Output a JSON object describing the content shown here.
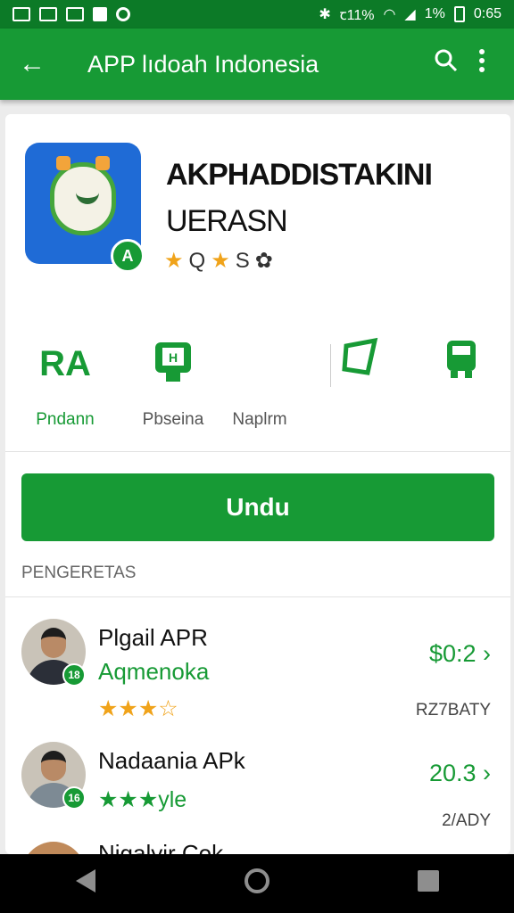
{
  "status_bar": {
    "battery_text": "1%",
    "extra_text": "ꞇ11%",
    "time": "0:65",
    "icons": [
      "image-icon",
      "cast-icon",
      "camera-icon",
      "square-icon",
      "record-icon",
      "bluetooth-icon",
      "wifi-icon",
      "signal-icon",
      "battery-icon"
    ]
  },
  "app_bar": {
    "title": "APP lıdoah Indonesia",
    "back_icon": "←",
    "search_icon": "search-icon",
    "more_icon": "more-vert-icon"
  },
  "app": {
    "title_line1": "AKPHADDISTAKINI",
    "title_line2": "UERASN",
    "rating_text_1": "Q",
    "rating_text_2": "S",
    "badge": "A",
    "icon_colors": {
      "background": "#1f6bd6",
      "robot": "#45a63c"
    }
  },
  "actions": [
    {
      "icon_text": "RA",
      "label": "Pndann"
    },
    {
      "icon_text": "H",
      "label": "Pbseina"
    },
    {
      "icon_text": "",
      "label": "Naplrm"
    },
    {
      "icon_text": "",
      "label": ""
    }
  ],
  "install_button": {
    "label": "Undu"
  },
  "section_title": "PENGERETAS",
  "list": [
    {
      "name": "Plgail APR",
      "subtitle": "Aqmenoka",
      "stars": "★★★☆",
      "price": "$0:2 ›",
      "meta": "RZ7BATY",
      "badge": "18"
    },
    {
      "name": "Nadaania APk",
      "subtitle": "",
      "stars_text": "★★★",
      "stars_suffix": "yle",
      "price": "20.3 ›",
      "meta": "2/ADY",
      "badge": "16"
    },
    {
      "name": "Nigalyir Cok",
      "subtitle": "",
      "stars": "",
      "price": "",
      "meta": "",
      "badge": ""
    }
  ],
  "nav": {
    "back": "back-icon",
    "home": "home-icon",
    "recent": "recent-apps-icon"
  },
  "colors": {
    "primary": "#179a35",
    "primary_dark": "#0c7a27",
    "star": "#f0a31a"
  }
}
